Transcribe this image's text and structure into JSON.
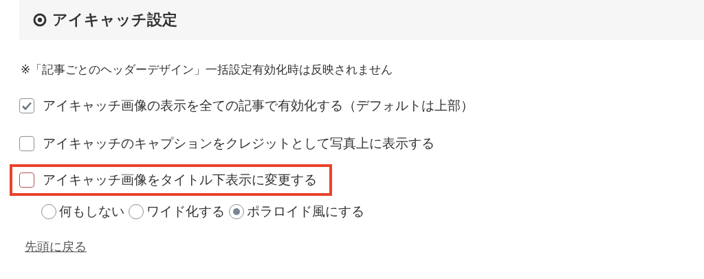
{
  "section": {
    "title": "アイキャッチ設定"
  },
  "note": "※「記事ごとのヘッダーデザイン」一括設定有効化時は反映されません",
  "options": [
    {
      "label": "アイキャッチ画像の表示を全ての記事で有効化する（デフォルトは上部）",
      "checked": true,
      "highlighted": false
    },
    {
      "label": "アイキャッチのキャプションをクレジットとして写真上に表示する",
      "checked": false,
      "highlighted": false
    },
    {
      "label": "アイキャッチ画像をタイトル下表示に変更する",
      "checked": false,
      "highlighted": true
    }
  ],
  "radios": [
    {
      "label": "何もしない",
      "selected": false
    },
    {
      "label": "ワイド化する",
      "selected": false
    },
    {
      "label": "ポラロイド風にする",
      "selected": true
    }
  ],
  "back_link": "先頭に戻る"
}
